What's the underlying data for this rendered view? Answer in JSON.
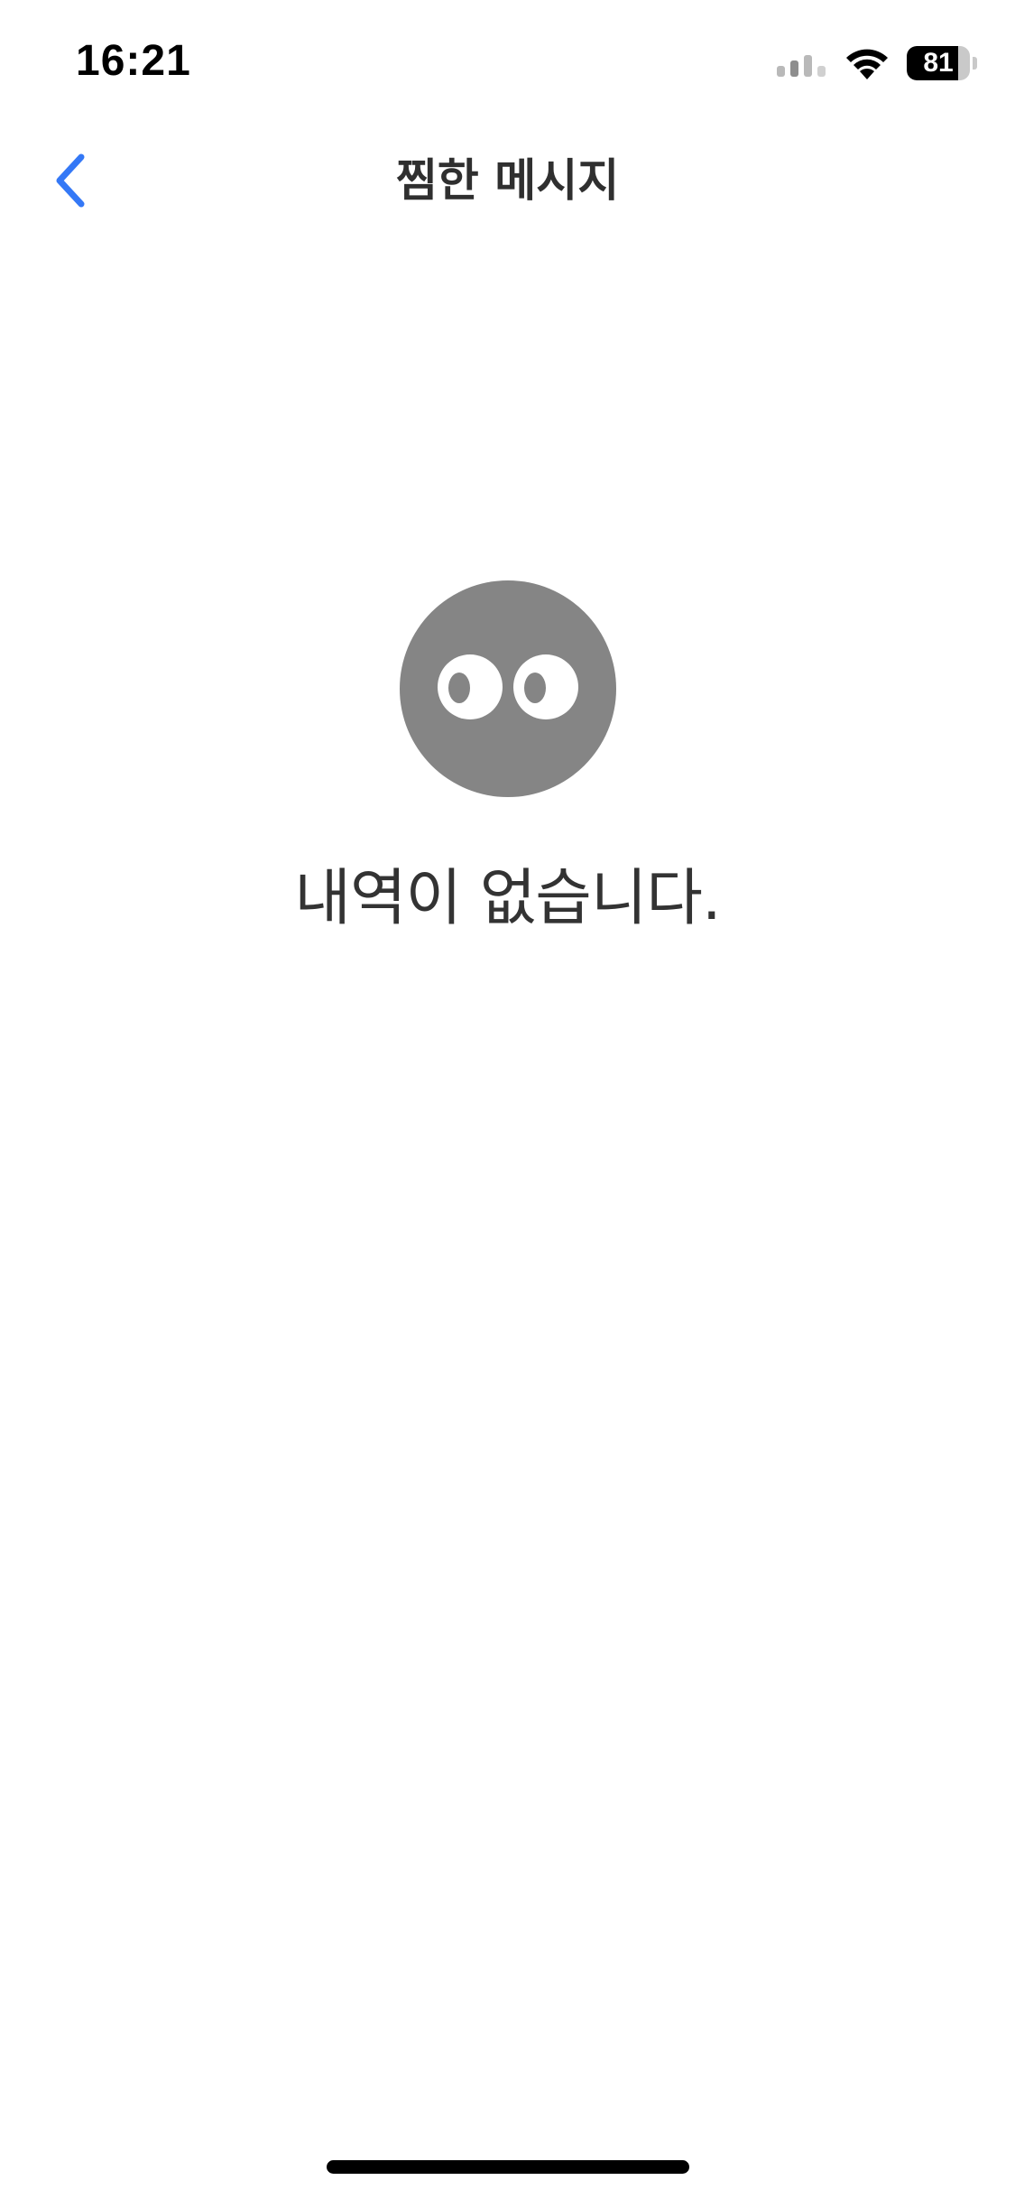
{
  "status_bar": {
    "time": "16:21",
    "battery_level": "81",
    "battery_fraction": 0.81,
    "icons": [
      "cellular-signal-icon",
      "wifi-icon",
      "battery-icon"
    ]
  },
  "nav": {
    "back_icon": "chevron-left-icon",
    "title": "찜한 메시지"
  },
  "empty_state": {
    "icon": "face-eyes-icon",
    "message": "내역이 없습니다."
  },
  "colors": {
    "accent": "#3478f6",
    "face": "#858585",
    "text": "#333333",
    "background": "#ffffff"
  }
}
